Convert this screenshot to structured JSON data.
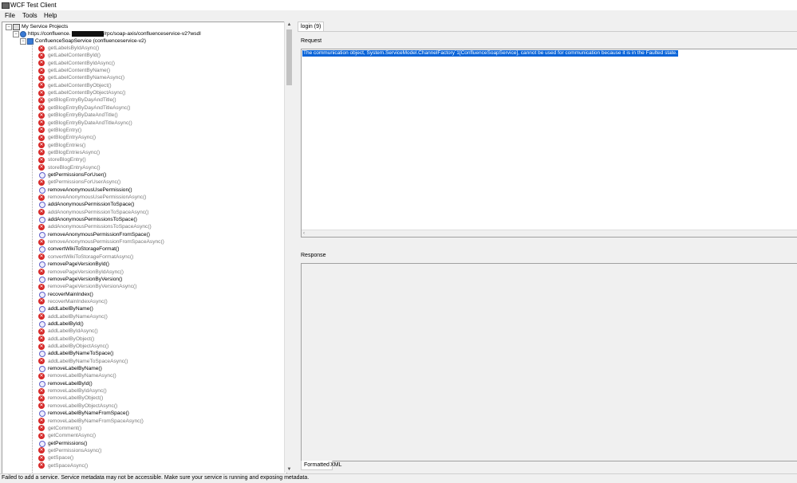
{
  "window": {
    "title": "WCF Test Client"
  },
  "menu": [
    "File",
    "Tools",
    "Help"
  ],
  "tree": {
    "root_label": "My Service Projects",
    "endpoint_prefix": "https://confluence.",
    "endpoint_suffix": "/rpc/soap-axis/confluenceservice-v2?wsdl",
    "service_label": "ConfluenceSoapService (confluenceservice-v2)",
    "operations": [
      {
        "name": "getLabelsByIdAsync()",
        "status": "error"
      },
      {
        "name": "getLabelContentById()",
        "status": "error"
      },
      {
        "name": "getLabelContentByIdAsync()",
        "status": "error"
      },
      {
        "name": "getLabelContentByName()",
        "status": "error"
      },
      {
        "name": "getLabelContentByNameAsync()",
        "status": "error"
      },
      {
        "name": "getLabelContentByObject()",
        "status": "error"
      },
      {
        "name": "getLabelContentByObjectAsync()",
        "status": "error"
      },
      {
        "name": "getBlogEntryByDayAndTitle()",
        "status": "error"
      },
      {
        "name": "getBlogEntryByDayAndTitleAsync()",
        "status": "error"
      },
      {
        "name": "getBlogEntryByDateAndTitle()",
        "status": "error"
      },
      {
        "name": "getBlogEntryByDateAndTitleAsync()",
        "status": "error"
      },
      {
        "name": "getBlogEntry()",
        "status": "error"
      },
      {
        "name": "getBlogEntryAsync()",
        "status": "error"
      },
      {
        "name": "getBlogEntries()",
        "status": "error"
      },
      {
        "name": "getBlogEntriesAsync()",
        "status": "error"
      },
      {
        "name": "storeBlogEntry()",
        "status": "error"
      },
      {
        "name": "storeBlogEntryAsync()",
        "status": "error"
      },
      {
        "name": "getPermissionsForUser()",
        "status": "ok"
      },
      {
        "name": "getPermissionsForUserAsync()",
        "status": "error"
      },
      {
        "name": "removeAnonymousUsePermission()",
        "status": "ok"
      },
      {
        "name": "removeAnonymousUsePermissionAsync()",
        "status": "error"
      },
      {
        "name": "addAnonymousPermissionToSpace()",
        "status": "ok"
      },
      {
        "name": "addAnonymousPermissionToSpaceAsync()",
        "status": "error"
      },
      {
        "name": "addAnonymousPermissionsToSpace()",
        "status": "ok"
      },
      {
        "name": "addAnonymousPermissionsToSpaceAsync()",
        "status": "error"
      },
      {
        "name": "removeAnonymousPermissionFromSpace()",
        "status": "ok"
      },
      {
        "name": "removeAnonymousPermissionFromSpaceAsync()",
        "status": "error"
      },
      {
        "name": "convertWikiToStorageFormat()",
        "status": "ok"
      },
      {
        "name": "convertWikiToStorageFormatAsync()",
        "status": "error"
      },
      {
        "name": "removePageVersionById()",
        "status": "ok"
      },
      {
        "name": "removePageVersionByIdAsync()",
        "status": "error"
      },
      {
        "name": "removePageVersionByVersion()",
        "status": "ok"
      },
      {
        "name": "removePageVersionByVersionAsync()",
        "status": "error"
      },
      {
        "name": "recoverMainIndex()",
        "status": "ok"
      },
      {
        "name": "recoverMainIndexAsync()",
        "status": "error"
      },
      {
        "name": "addLabelByName()",
        "status": "ok"
      },
      {
        "name": "addLabelByNameAsync()",
        "status": "error"
      },
      {
        "name": "addLabelById()",
        "status": "ok"
      },
      {
        "name": "addLabelByIdAsync()",
        "status": "error"
      },
      {
        "name": "addLabelByObject()",
        "status": "error"
      },
      {
        "name": "addLabelByObjectAsync()",
        "status": "error"
      },
      {
        "name": "addLabelByNameToSpace()",
        "status": "ok"
      },
      {
        "name": "addLabelByNameToSpaceAsync()",
        "status": "error"
      },
      {
        "name": "removeLabelByName()",
        "status": "ok"
      },
      {
        "name": "removeLabelByNameAsync()",
        "status": "error"
      },
      {
        "name": "removeLabelById()",
        "status": "ok"
      },
      {
        "name": "removeLabelByIdAsync()",
        "status": "error"
      },
      {
        "name": "removeLabelByObject()",
        "status": "error"
      },
      {
        "name": "removeLabelByObjectAsync()",
        "status": "error"
      },
      {
        "name": "removeLabelByNameFromSpace()",
        "status": "ok"
      },
      {
        "name": "removeLabelByNameFromSpaceAsync()",
        "status": "error"
      },
      {
        "name": "getComment()",
        "status": "error"
      },
      {
        "name": "getCommentAsync()",
        "status": "error"
      },
      {
        "name": "getPermissions()",
        "status": "ok"
      },
      {
        "name": "getPermissionsAsync()",
        "status": "error"
      },
      {
        "name": "getSpace()",
        "status": "error"
      },
      {
        "name": "getSpaceAsync()",
        "status": "error"
      }
    ]
  },
  "right": {
    "tab_label": "login (9)",
    "request_label": "Request",
    "request_text": "The communication object, System.ServiceModel.ChannelFactory`1[ConfluenceSoapService], cannot be used for communication because it is in the Faulted state.",
    "response_label": "Response",
    "bottom_tabs": [
      "Formatted",
      "XML"
    ]
  },
  "status": {
    "message": "Failed to add a service. Service metadata may not be accessible. Make sure your service is running and exposing metadata."
  },
  "colors": {
    "error": "#d62828",
    "selection": "#0a64d8",
    "ok": "#5d5dc8"
  }
}
